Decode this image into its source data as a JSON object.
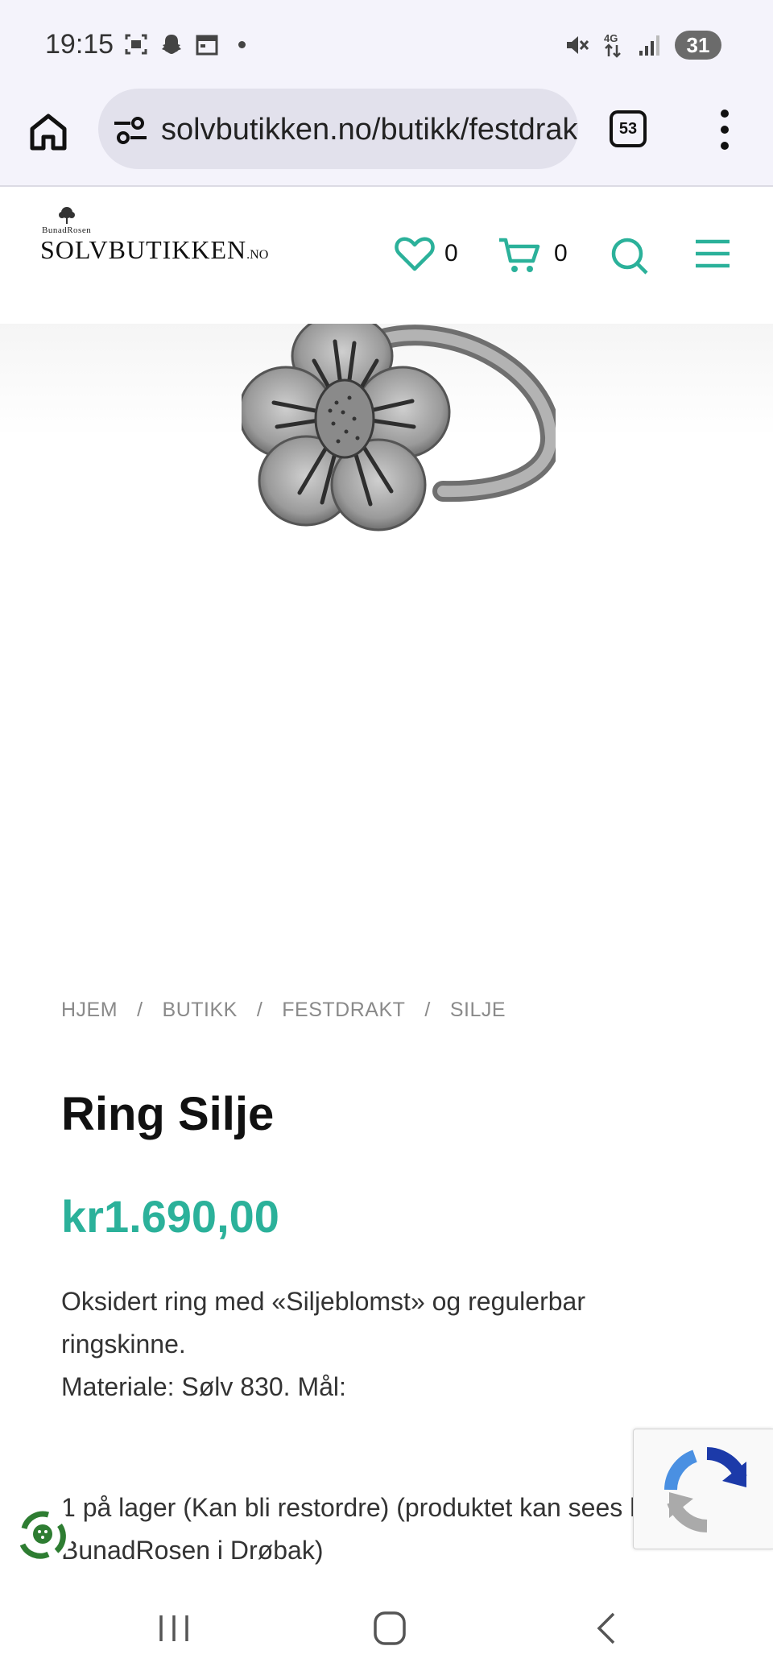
{
  "status_bar": {
    "time": "19:15",
    "battery": "31",
    "icons": [
      "screenshot-icon",
      "snapchat-icon",
      "calendar-icon",
      "mute-icon",
      "4g-icon",
      "signal-icon"
    ]
  },
  "browser": {
    "url": "solvbutikken.no/butikk/festdrakt",
    "tab_count": "53"
  },
  "site": {
    "logo_small": "BunadRosen",
    "logo_main": "SOLVBUTIKKEN",
    "logo_suffix": ".NO",
    "wishlist_count": "0",
    "cart_count": "0",
    "accent_color": "#2bb19a"
  },
  "breadcrumb": [
    "HJEM",
    "BUTIKK",
    "FESTDRAKT",
    "SILJE"
  ],
  "breadcrumb_separator": "/",
  "product": {
    "title": "Ring Silje",
    "price": "kr1.690,00",
    "desc_line1": "Oksidert ring med «Siljeblomst» og regulerbar ringskinne.",
    "desc_line2": "Materiale: Sølv 830. Mål:",
    "stock_text": "1 på lager (Kan bli restordre) (produktet kan sees hos BunadRosen i Drøbak)"
  }
}
